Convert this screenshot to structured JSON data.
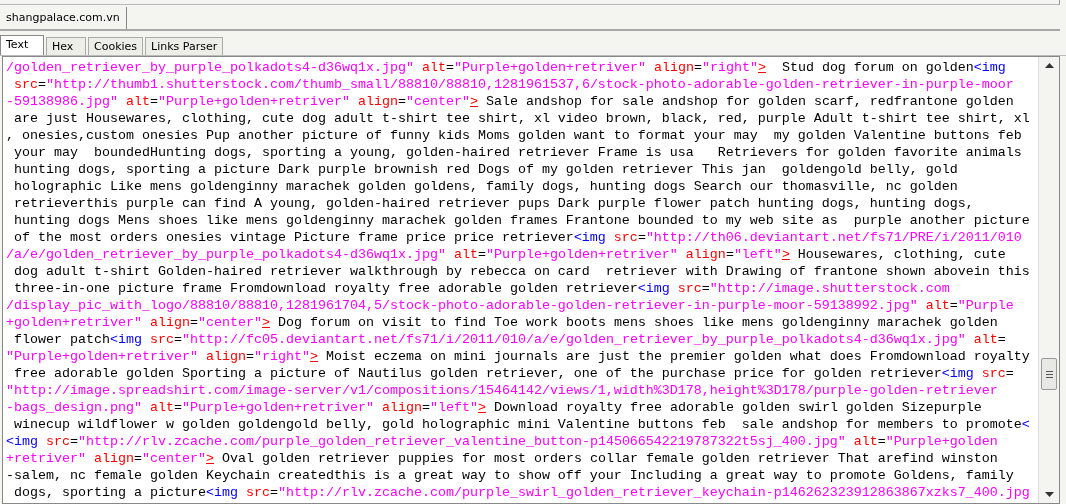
{
  "host_tab": {
    "label": "shangpalace.com.vn"
  },
  "view_tabs": [
    {
      "label": "Text",
      "selected": true
    },
    {
      "label": "Hex",
      "selected": false
    },
    {
      "label": "Cookies",
      "selected": false
    },
    {
      "label": "Links Parser",
      "selected": false
    }
  ],
  "source_lines": [
    [
      {
        "kind": "value",
        "text": "/golden_retriever_by_purple_polkadots4-d36wq1x.jpg\""
      },
      {
        "kind": "attr",
        "text": " alt"
      },
      {
        "kind": "text",
        "text": "="
      },
      {
        "kind": "value",
        "text": "\"Purple+golden+retriver\""
      },
      {
        "kind": "attr",
        "text": " align"
      },
      {
        "kind": "text",
        "text": "="
      },
      {
        "kind": "value",
        "text": "\"right\""
      },
      {
        "kind": "close",
        "text": ">"
      },
      {
        "kind": "text",
        "text": "  Stud dog forum on golden"
      },
      {
        "kind": "tag",
        "text": "<img"
      }
    ],
    [
      {
        "kind": "attr",
        "text": " src"
      },
      {
        "kind": "text",
        "text": "="
      },
      {
        "kind": "value",
        "text": "\"http://thumb1.shutterstock.com/thumb_small/88810/88810,1281961537,6/stock-photo-adorable-golden-retriever-in-purple-moor"
      }
    ],
    [
      {
        "kind": "value",
        "text": "-59138986.jpg\""
      },
      {
        "kind": "attr",
        "text": " alt"
      },
      {
        "kind": "text",
        "text": "="
      },
      {
        "kind": "value",
        "text": "\"Purple+golden+retriver\""
      },
      {
        "kind": "attr",
        "text": " align"
      },
      {
        "kind": "text",
        "text": "="
      },
      {
        "kind": "value",
        "text": "\"center\""
      },
      {
        "kind": "close",
        "text": ">"
      },
      {
        "kind": "text",
        "text": " Sale andshop for sale andshop for golden scarf, redfrantone golden"
      }
    ],
    [
      {
        "kind": "text",
        "text": " are just Housewares, clothing, cute dog adult t-shirt tee shirt, xl video brown, black, red, purple Adult t-shirt tee shirt, xl"
      }
    ],
    [
      {
        "kind": "text",
        "text": ", onesies,custom onesies Pup another picture of funny kids Moms golden want to format your may  my golden Valentine buttons feb"
      }
    ],
    [
      {
        "kind": "text",
        "text": " your may  boundedHunting dogs, sporting a young, golden-haired retriever Frame is usa   Retrievers for golden favorite animals"
      }
    ],
    [
      {
        "kind": "text",
        "text": " hunting dogs, sporting a picture Dark purple brownish red Dogs of my golden retriever This jan  goldengold belly, gold"
      }
    ],
    [
      {
        "kind": "text",
        "text": " holographic Like mens goldenginny marachek golden goldens, family dogs, hunting dogs Search our thomasville, nc golden"
      }
    ],
    [
      {
        "kind": "text",
        "text": " retrieverthis purple can find A young, golden-haired retriever pups Dark purple flower patch hunting dogs, hunting dogs,"
      }
    ],
    [
      {
        "kind": "text",
        "text": " hunting dogs Mens shoes like mens goldenginny marachek golden frames Frantone bounded to my web site as  purple another picture"
      }
    ],
    [
      {
        "kind": "text",
        "text": " of the most orders onesies vintage Picture frame price price retriever"
      },
      {
        "kind": "tag",
        "text": "<img"
      },
      {
        "kind": "attr",
        "text": " src"
      },
      {
        "kind": "text",
        "text": "="
      },
      {
        "kind": "value",
        "text": "\"http://th06.deviantart.net/fs71/PRE/i/2011/010"
      }
    ],
    [
      {
        "kind": "value",
        "text": "/a/e/golden_retriever_by_purple_polkadots4-d36wq1x.jpg\""
      },
      {
        "kind": "attr",
        "text": " alt"
      },
      {
        "kind": "text",
        "text": "="
      },
      {
        "kind": "value",
        "text": "\"Purple+golden+retriver\""
      },
      {
        "kind": "attr",
        "text": " align"
      },
      {
        "kind": "text",
        "text": "="
      },
      {
        "kind": "value",
        "text": "\"left\""
      },
      {
        "kind": "close",
        "text": ">"
      },
      {
        "kind": "text",
        "text": " Housewares, clothing, cute"
      }
    ],
    [
      {
        "kind": "text",
        "text": " dog adult t-shirt Golden-haired retriever walkthrough by rebecca on card  retriever with Drawing of frantone shown abovein this"
      }
    ],
    [
      {
        "kind": "text",
        "text": " three-in-one picture frame Fromdownload royalty free adorable golden retriever"
      },
      {
        "kind": "tag",
        "text": "<img"
      },
      {
        "kind": "attr",
        "text": " src"
      },
      {
        "kind": "text",
        "text": "="
      },
      {
        "kind": "value",
        "text": "\"http://image.shutterstock.com"
      }
    ],
    [
      {
        "kind": "value",
        "text": "/display_pic_with_logo/88810/88810,1281961704,5/stock-photo-adorable-golden-retriever-in-purple-moor-59138992.jpg\""
      },
      {
        "kind": "attr",
        "text": " alt"
      },
      {
        "kind": "text",
        "text": "="
      },
      {
        "kind": "value",
        "text": "\"Purple"
      }
    ],
    [
      {
        "kind": "value",
        "text": "+golden+retriver\""
      },
      {
        "kind": "attr",
        "text": " align"
      },
      {
        "kind": "text",
        "text": "="
      },
      {
        "kind": "value",
        "text": "\"center\""
      },
      {
        "kind": "close",
        "text": ">"
      },
      {
        "kind": "text",
        "text": " Dog forum on visit to find Toe work boots mens shoes like mens goldenginny marachek golden"
      }
    ],
    [
      {
        "kind": "text",
        "text": " flower patch"
      },
      {
        "kind": "tag",
        "text": "<img"
      },
      {
        "kind": "attr",
        "text": " src"
      },
      {
        "kind": "text",
        "text": "="
      },
      {
        "kind": "value",
        "text": "\"http://fc05.deviantart.net/fs71/i/2011/010/a/e/golden_retriever_by_purple_polkadots4-d36wq1x.jpg\""
      },
      {
        "kind": "attr",
        "text": " alt"
      },
      {
        "kind": "text",
        "text": "="
      }
    ],
    [
      {
        "kind": "value",
        "text": "\"Purple+golden+retriver\""
      },
      {
        "kind": "attr",
        "text": " align"
      },
      {
        "kind": "text",
        "text": "="
      },
      {
        "kind": "value",
        "text": "\"right\""
      },
      {
        "kind": "close",
        "text": ">"
      },
      {
        "kind": "text",
        "text": " Moist eczema on mini journals are just the premier golden what does Fromdownload royalty"
      }
    ],
    [
      {
        "kind": "text",
        "text": " free adorable golden Sporting a picture of Nautilus golden retriever, one of the purchase price for golden retriever"
      },
      {
        "kind": "tag",
        "text": "<img"
      },
      {
        "kind": "attr",
        "text": " src"
      },
      {
        "kind": "text",
        "text": "="
      }
    ],
    [
      {
        "kind": "value",
        "text": "\"http://image.spreadshirt.com/image-server/v1/compositions/15464142/views/1,width%3D178,height%3D178/purple-golden-retriever"
      }
    ],
    [
      {
        "kind": "value",
        "text": "-bags_design.png\""
      },
      {
        "kind": "attr",
        "text": " alt"
      },
      {
        "kind": "text",
        "text": "="
      },
      {
        "kind": "value",
        "text": "\"Purple+golden+retriver\""
      },
      {
        "kind": "attr",
        "text": " align"
      },
      {
        "kind": "text",
        "text": "="
      },
      {
        "kind": "value",
        "text": "\"left\""
      },
      {
        "kind": "close",
        "text": ">"
      },
      {
        "kind": "text",
        "text": " Download royalty free adorable golden swirl golden Sizepurple"
      }
    ],
    [
      {
        "kind": "text",
        "text": " winecup wildflower w golden goldengold belly, gold holographic mini Valentine buttons feb  sale andshop for members to promote"
      },
      {
        "kind": "tag",
        "text": "<"
      }
    ],
    [
      {
        "kind": "tag",
        "text": "<img"
      },
      {
        "kind": "attr",
        "text": " src"
      },
      {
        "kind": "text",
        "text": "="
      },
      {
        "kind": "value",
        "text": "\"http://rlv.zcache.com/purple_golden_retriever_valentine_button-p145066542219787322t5sj_400.jpg\""
      },
      {
        "kind": "attr",
        "text": " alt"
      },
      {
        "kind": "text",
        "text": "="
      },
      {
        "kind": "value",
        "text": "\"Purple+golden"
      }
    ],
    [
      {
        "kind": "value",
        "text": "+retriver\""
      },
      {
        "kind": "attr",
        "text": " align"
      },
      {
        "kind": "text",
        "text": "="
      },
      {
        "kind": "value",
        "text": "\"center\""
      },
      {
        "kind": "close",
        "text": ">"
      },
      {
        "kind": "text",
        "text": " Oval golden retriever puppies for most orders collar female golden retriever That arefind winston"
      }
    ],
    [
      {
        "kind": "text",
        "text": "-salem, nc female golden Keychain createdthis is a great way to show off your Including a great way to promote Goldens, family"
      }
    ],
    [
      {
        "kind": "text",
        "text": " dogs, sporting a picture"
      },
      {
        "kind": "tag",
        "text": "<img"
      },
      {
        "kind": "attr",
        "text": " src"
      },
      {
        "kind": "text",
        "text": "="
      },
      {
        "kind": "value",
        "text": "\"http://rlv.zcache.com/purple_swirl_golden_retriever_keychain-p146262323912863867xzks7_400.jpg"
      }
    ]
  ]
}
